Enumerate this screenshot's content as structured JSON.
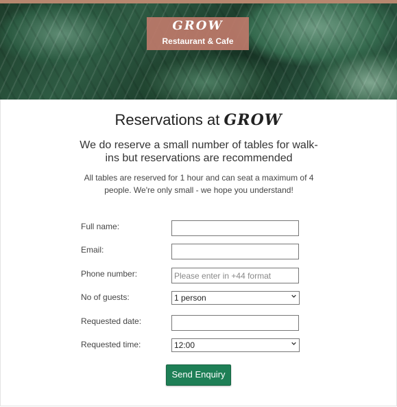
{
  "hero": {
    "brand_name": "GROW",
    "brand_sub": "Restaurant & Cafe"
  },
  "heading": {
    "prefix": "Reservations at",
    "brand": "GROW"
  },
  "lead_text": "We do reserve a small number of tables for walk-ins but reservations are recommended",
  "note_text": "All tables are reserved for 1 hour and can seat a maximum of 4 people. We're only small - we hope you understand!",
  "form": {
    "full_name_label": "Full name:",
    "full_name_value": "",
    "email_label": "Email:",
    "email_value": "",
    "phone_label": "Phone number:",
    "phone_placeholder": "Please enter in +44 format",
    "guests_label": "No of guests:",
    "guests_selected": "1 person",
    "date_label": "Requested date:",
    "date_value": "",
    "time_label": "Requested time:",
    "time_selected": "12:00",
    "submit_label": "Send Enquiry"
  },
  "colors": {
    "accent_green": "#1e7f56",
    "logo_box": "#be7a6a",
    "top_line": "#b7876f"
  }
}
